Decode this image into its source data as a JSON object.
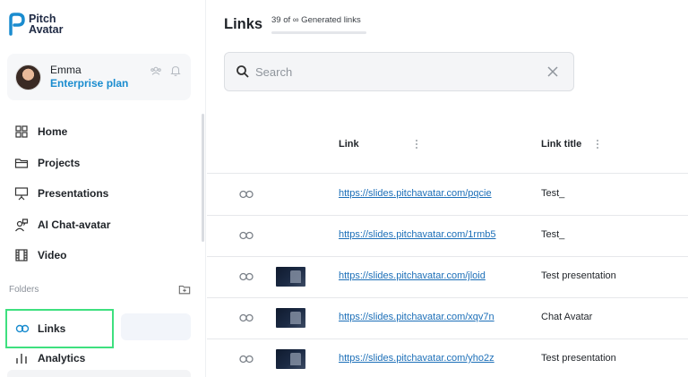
{
  "logo": {
    "line1": "Pitch",
    "line2": "Avatar"
  },
  "user": {
    "name": "Emma",
    "plan": "Enterprise plan"
  },
  "nav": [
    {
      "label": "Home",
      "icon": "grid-icon"
    },
    {
      "label": "Projects",
      "icon": "folder-icon"
    },
    {
      "label": "Presentations",
      "icon": "presentation-icon"
    },
    {
      "label": "AI Chat-avatar",
      "icon": "chat-avatar-icon"
    },
    {
      "label": "Video",
      "icon": "film-icon"
    }
  ],
  "folders": {
    "label": "Folders"
  },
  "links_nav": {
    "label": "Links"
  },
  "analytics_nav": {
    "label": "Analytics"
  },
  "page": {
    "title": "Links",
    "count": "39 of ∞ Generated links"
  },
  "search": {
    "placeholder": "Search",
    "value": ""
  },
  "table": {
    "columns": [
      "Link",
      "Link title"
    ],
    "rows": [
      {
        "url": "https://slides.pitchavatar.com/pqcie",
        "title": "Test_",
        "has_thumb": false
      },
      {
        "url": "https://slides.pitchavatar.com/1rmb5",
        "title": "Test_",
        "has_thumb": false
      },
      {
        "url": "https://slides.pitchavatar.com/jloid",
        "title": "Test presentation",
        "has_thumb": true
      },
      {
        "url": "https://slides.pitchavatar.com/xqv7n",
        "title": "Chat Avatar",
        "has_thumb": true
      },
      {
        "url": "https://slides.pitchavatar.com/yho2z",
        "title": "Test presentation",
        "has_thumb": true
      }
    ]
  },
  "colors": {
    "accent": "#1a8ccf",
    "link": "#1c6fb8",
    "highlight": "#3ee07f"
  }
}
